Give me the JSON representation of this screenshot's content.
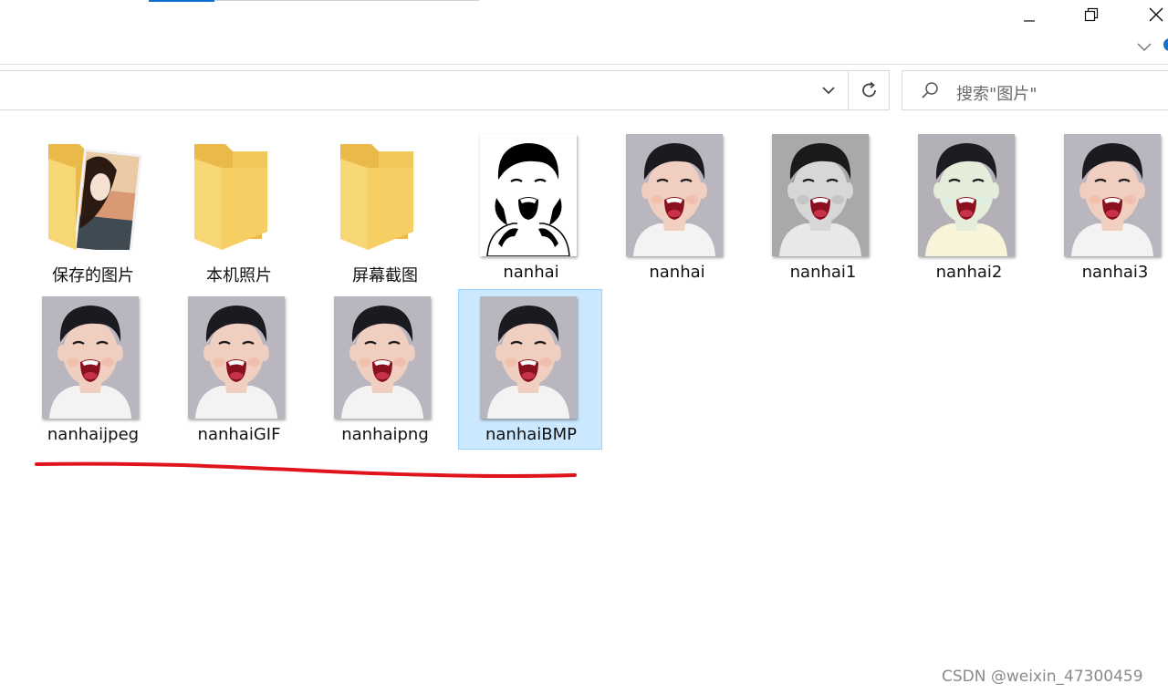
{
  "window": {
    "minimize_icon": "minimize-icon",
    "restore_icon": "restore-icon",
    "close_icon": "close-icon"
  },
  "search": {
    "placeholder": "搜索\"图片\""
  },
  "folders": [
    {
      "label": "保存的图片"
    },
    {
      "label": "本机照片"
    },
    {
      "label": "屏幕截图"
    }
  ],
  "files": [
    {
      "label": "nanhai",
      "style": "bw"
    },
    {
      "label": "nanhai",
      "style": "color"
    },
    {
      "label": "nanhai1",
      "style": "gray"
    },
    {
      "label": "nanhai2",
      "style": "tint"
    },
    {
      "label": "nanhai3",
      "style": "color"
    },
    {
      "label": "nanhaijpeg",
      "style": "color"
    },
    {
      "label": "nanhaiGIF",
      "style": "color"
    },
    {
      "label": "nanhaipng",
      "style": "color"
    },
    {
      "label": "nanhaiBMP",
      "style": "color",
      "selected": true
    }
  ],
  "colors": {
    "selection_bg": "#cce8ff",
    "selection_border": "#99d1ff",
    "folder_yellow": "#f7d774",
    "annotation_red": "#e0141c"
  },
  "watermark": "CSDN @weixin_47300459"
}
